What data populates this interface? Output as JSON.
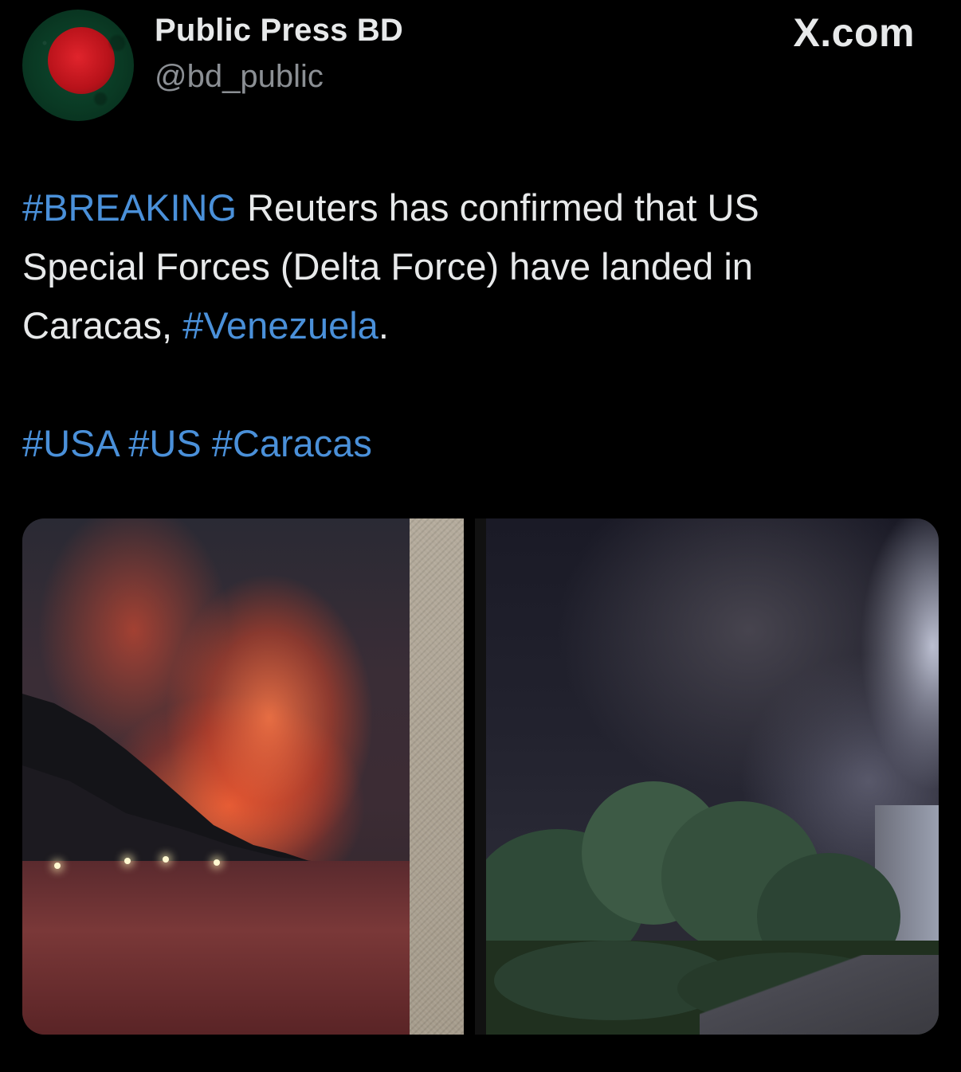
{
  "header": {
    "display_name": "Public Press BD",
    "handle": "@bd_public",
    "source": "X.com"
  },
  "tweet": {
    "hashtag_breaking": "#BREAKING",
    "text_line1": " Reuters has confirmed that US",
    "text_line2": "Special Forces (Delta Force) have landed in",
    "text_line3_prefix": "Caracas, ",
    "hashtag_venezuela": "#Venezuela",
    "text_line3_suffix": ".",
    "hashtag_usa": "#USA",
    "hashtag_us": "#US",
    "hashtag_caracas": "#Caracas"
  },
  "colors": {
    "background": "#000000",
    "text": "#e7e9ea",
    "secondary_text": "#8b8f94",
    "hashtag": "#4a90d9"
  },
  "media": {
    "left_image": "fire-over-mountain-coast-night-photo",
    "right_image": "smoke-over-trees-night-photo"
  }
}
